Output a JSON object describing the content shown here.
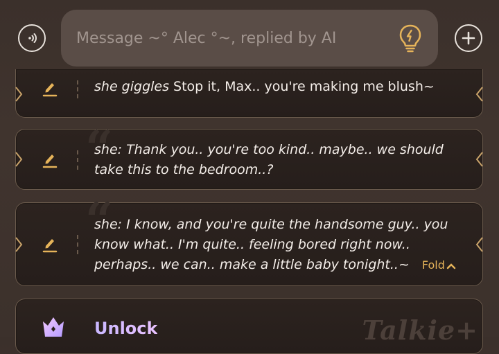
{
  "composer": {
    "placeholder": "Message ~° Alec °~, replied by AI",
    "voice_icon": "voice-call-icon",
    "hint_icon": "lightbulb-icon",
    "add_icon": "plus-icon"
  },
  "messages": [
    {
      "prefix_italic": "she giggles",
      "text": " Stop it, Max.. you're making me blush~"
    },
    {
      "prefix_italic": "she: Thank you.. you're too kind.. maybe.. we should take this to the bedroom..?",
      "text": ""
    },
    {
      "prefix_italic": "she: I know, and you're quite the handsome guy.. you know what.. I'm quite.. feeling bored right now.. perhaps.. we can.. make a little baby tonight..~",
      "text": "",
      "fold_label": "Fold"
    }
  ],
  "unlock": {
    "title": "Unlock",
    "brand": "Talkie+"
  },
  "colors": {
    "accent_gold": "#e6b45a",
    "unlock_gradient": "#c9b7ff"
  }
}
